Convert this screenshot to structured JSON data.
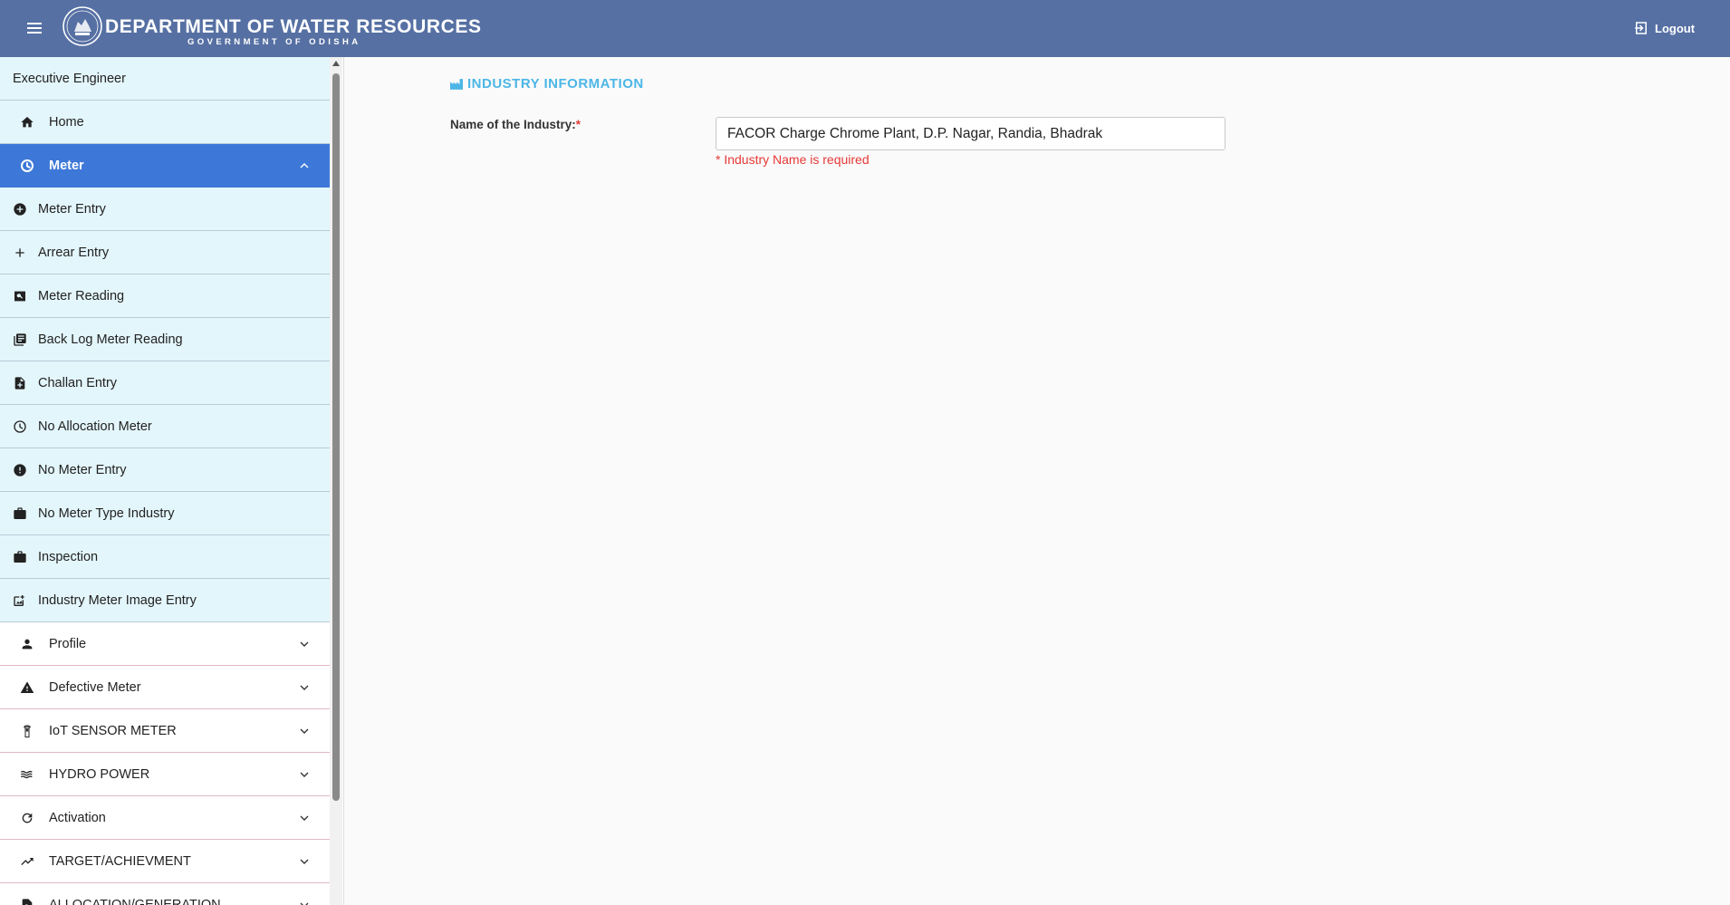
{
  "header": {
    "title": "DEPARTMENT OF WATER RESOURCES",
    "subtitle": "GOVERNMENT OF ODISHA",
    "logout_label": "Logout"
  },
  "sidebar": {
    "user_role": "Executive Engineer",
    "home": {
      "label": "Home",
      "icon": "home-icon"
    },
    "meter": {
      "label": "Meter",
      "icon": "meter-icon",
      "expanded": true
    },
    "meter_items": [
      {
        "label": "Meter Entry",
        "icon": "add-circle-icon"
      },
      {
        "label": "Arrear Entry",
        "icon": "plus-icon"
      },
      {
        "label": "Meter Reading",
        "icon": "image-search-icon"
      },
      {
        "label": "Back Log Meter Reading",
        "icon": "library-books-icon"
      },
      {
        "label": "Challan Entry",
        "icon": "document-add-icon"
      },
      {
        "label": "No Allocation Meter",
        "icon": "meter-icon"
      },
      {
        "label": "No Meter Entry",
        "icon": "alert-circle-icon"
      },
      {
        "label": "No Meter Type Industry",
        "icon": "briefcase-icon"
      },
      {
        "label": "Inspection",
        "icon": "briefcase-icon"
      },
      {
        "label": "Industry Meter Image Entry",
        "icon": "add-photo-icon"
      }
    ],
    "groups": [
      {
        "label": "Profile",
        "icon": "person-icon"
      },
      {
        "label": "Defective Meter",
        "icon": "warning-icon"
      },
      {
        "label": "IoT SENSOR METER",
        "icon": "sensor-icon"
      },
      {
        "label": "HYDRO POWER",
        "icon": "waves-icon"
      },
      {
        "label": "Activation",
        "icon": "refresh-icon"
      },
      {
        "label": "TARGET/ACHIEVMENT",
        "icon": "trending-up-icon"
      },
      {
        "label": "ALLOCATION/GENERATION",
        "icon": "search-document-icon"
      }
    ]
  },
  "main": {
    "section_title": "INDUSTRY INFORMATION",
    "industry_label": "Name of the Industry:",
    "required_mark": "*",
    "industry_value": "FACOR Charge Chrome Plant, D.P. Nagar, Randia, Bhadrak",
    "error_text": "* Industry Name is required"
  },
  "colors": {
    "header_bg": "#5670a3",
    "active_item_bg": "#3d78d8",
    "submenu_bg": "#e3f6fb",
    "accent": "#4cb6e6",
    "error": "#e53935"
  }
}
